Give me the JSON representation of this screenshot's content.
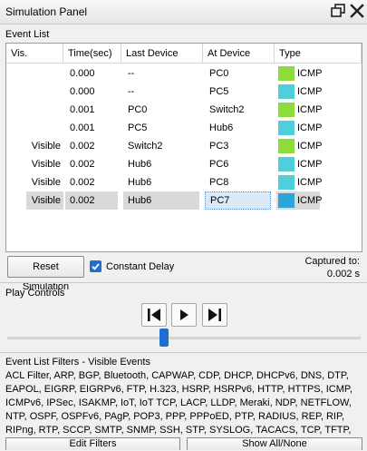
{
  "panel": {
    "title": "Simulation Panel",
    "float_icon": "restore-window-icon",
    "close_icon": "close-icon"
  },
  "event_list": {
    "label": "Event List",
    "columns": [
      "Vis.",
      "Time(sec)",
      "Last Device",
      "At Device",
      "Type"
    ],
    "rows": [
      {
        "vis": "",
        "time": "0.000",
        "last": "--",
        "at": "PC0",
        "type": "ICMP",
        "color": "#8ddc3c"
      },
      {
        "vis": "",
        "time": "0.000",
        "last": "--",
        "at": "PC5",
        "type": "ICMP",
        "color": "#4fcfdb"
      },
      {
        "vis": "",
        "time": "0.001",
        "last": "PC0",
        "at": "Switch2",
        "type": "ICMP",
        "color": "#8ddc3c"
      },
      {
        "vis": "",
        "time": "0.001",
        "last": "PC5",
        "at": "Hub6",
        "type": "ICMP",
        "color": "#4fcfdb"
      },
      {
        "vis": "Visible",
        "time": "0.002",
        "last": "Switch2",
        "at": "PC3",
        "type": "ICMP",
        "color": "#8ddc3c"
      },
      {
        "vis": "Visible",
        "time": "0.002",
        "last": "Hub6",
        "at": "PC6",
        "type": "ICMP",
        "color": "#4fcfdb"
      },
      {
        "vis": "Visible",
        "time": "0.002",
        "last": "Hub6",
        "at": "PC8",
        "type": "ICMP",
        "color": "#4fcfdb"
      },
      {
        "vis": "Visible",
        "time": "0.002",
        "last": "Hub6",
        "at": "PC7",
        "type": "ICMP",
        "color": "#2ba6d6",
        "selected": true
      }
    ]
  },
  "controls": {
    "reset_label": "Reset Simulation",
    "constant_delay_label": "Constant Delay",
    "constant_delay_checked": true,
    "captured_label": "Captured to:",
    "captured_value": "0.002 s"
  },
  "play_controls": {
    "label": "Play Controls",
    "back_icon": "step-back-icon",
    "play_icon": "play-icon",
    "forward_icon": "step-forward-icon",
    "accent": "#1f6fd1"
  },
  "filters": {
    "label": "Event List Filters - Visible Events",
    "text": "ACL Filter, ARP, BGP, Bluetooth, CAPWAP, CDP, DHCP, DHCPv6, DNS, DTP, EAPOL, EIGRP, EIGRPv6, FTP, H.323, HSRP, HSRPv6, HTTP, HTTPS, ICMP, ICMPv6, IPSec, ISAKMP, IoT, IoT TCP, LACP, LLDP, Meraki, NDP, NETFLOW, NTP, OSPF, OSPFv6, PAgP, POP3, PPP, PPPoED, PTP, RADIUS, REP, RIP, RIPng, RTP, SCCP, SMTP, SNMP, SSH, STP, SYSLOG, TACACS, TCP, TFTP, Telnet, UDP, USB, VTP",
    "edit_label": "Edit Filters",
    "show_all_label": "Show All/None"
  }
}
